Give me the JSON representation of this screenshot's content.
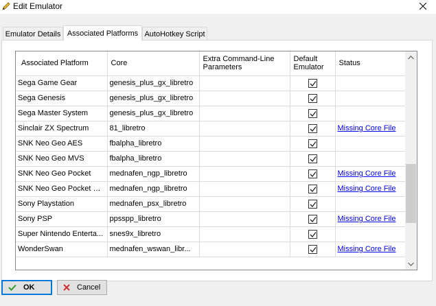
{
  "window": {
    "title": "Edit Emulator"
  },
  "tabs": [
    {
      "label": "Emulator Details",
      "active": false
    },
    {
      "label": "Associated Platforms",
      "active": true
    },
    {
      "label": "AutoHotkey Script",
      "active": false
    }
  ],
  "grid": {
    "columns": [
      "Associated Platform",
      "Core",
      "Extra Command-Line Parameters",
      "Default Emulator",
      "Status"
    ],
    "rows": [
      {
        "platform": "Sega Game Gear",
        "core": "genesis_plus_gx_libretro",
        "params": "",
        "default": true,
        "status": ""
      },
      {
        "platform": "Sega Genesis",
        "core": "genesis_plus_gx_libretro",
        "params": "",
        "default": true,
        "status": ""
      },
      {
        "platform": "Sega Master System",
        "core": "genesis_plus_gx_libretro",
        "params": "",
        "default": true,
        "status": ""
      },
      {
        "platform": "Sinclair ZX Spectrum",
        "core": "81_libretro",
        "params": "",
        "default": true,
        "status": "Missing Core File"
      },
      {
        "platform": "SNK Neo Geo AES",
        "core": "fbalpha_libretro",
        "params": "",
        "default": true,
        "status": ""
      },
      {
        "platform": "SNK Neo Geo MVS",
        "core": "fbalpha_libretro",
        "params": "",
        "default": true,
        "status": ""
      },
      {
        "platform": "SNK Neo Geo Pocket",
        "core": "mednafen_ngp_libretro",
        "params": "",
        "default": true,
        "status": "Missing Core File"
      },
      {
        "platform": "SNK Neo Geo Pocket C...",
        "core": "mednafen_ngp_libretro",
        "params": "",
        "default": true,
        "status": "Missing Core File"
      },
      {
        "platform": "Sony Playstation",
        "core": "mednafen_psx_libretro",
        "params": "",
        "default": true,
        "status": ""
      },
      {
        "platform": "Sony PSP",
        "core": "ppsspp_libretro",
        "params": "",
        "default": true,
        "status": "Missing Core File"
      },
      {
        "platform": "Super Nintendo Enterta...",
        "core": "snes9x_libretro",
        "params": "",
        "default": true,
        "status": ""
      },
      {
        "platform": "WonderSwan",
        "core": "mednafen_wswan_libr...",
        "params": "",
        "default": true,
        "status": "Missing Core File"
      }
    ]
  },
  "buttons": {
    "ok_label": "OK",
    "cancel_label": "Cancel"
  },
  "icons": {
    "title": "pencil-icon",
    "close": "close-icon",
    "ok": "check-icon",
    "cancel": "x-icon",
    "scroll_up": "chevron-up-icon",
    "scroll_down": "chevron-down-icon"
  },
  "colors": {
    "link": "#0000ee",
    "ok_check": "#2e9e2e",
    "cancel_x": "#d03030",
    "default_button_border": "#0078d7"
  }
}
